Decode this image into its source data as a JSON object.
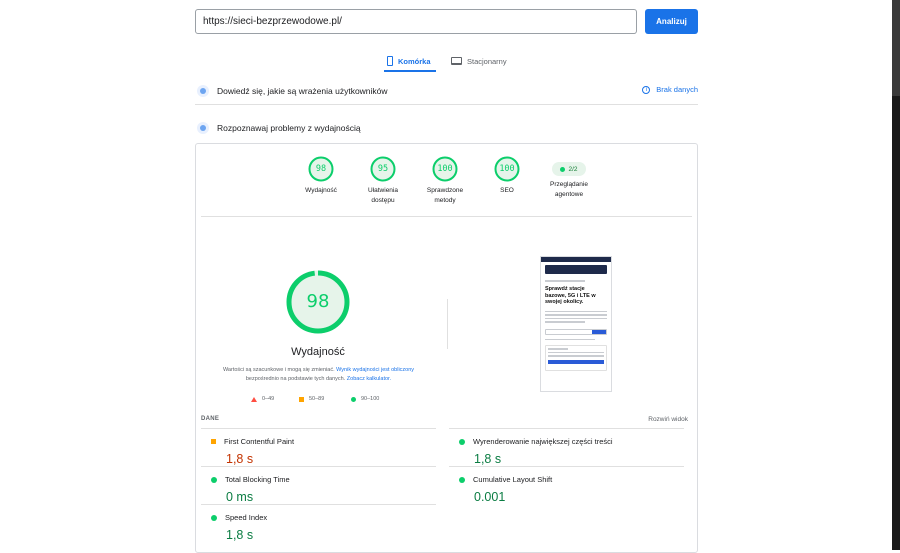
{
  "url_bar": {
    "value": "https://sieci-bezprzewodowe.pl/",
    "analyze_label": "Analizuj"
  },
  "device_tabs": {
    "mobile": "Komórka",
    "desktop": "Stacjonarny"
  },
  "field_section": {
    "title": "Dowiedź się, jakie są wrażenia użytkowników",
    "no_data": "Brak danych"
  },
  "lab_section": {
    "title": "Rozpoznawaj problemy z wydajnością"
  },
  "category_scores": [
    {
      "score": "98",
      "label_line1": "Wydajność",
      "label_line2": ""
    },
    {
      "score": "95",
      "label_line1": "Ułatwienia",
      "label_line2": "dostępu"
    },
    {
      "score": "100",
      "label_line1": "Sprawdzone",
      "label_line2": "metody"
    },
    {
      "score": "100",
      "label_line1": "SEO",
      "label_line2": ""
    }
  ],
  "agentic": {
    "value": "2/2",
    "label_line1": "Przeglądanie",
    "label_line2": "agentowe"
  },
  "performance": {
    "score": "98",
    "score_fraction": 0.98,
    "label": "Wydajność",
    "disclaimer_pre": "Wartości są szacunkowe i mogą się zmieniać.",
    "disclaimer_link1": "Wynik wydajności jest obliczony",
    "disclaimer_mid": "bezpośrednio na podstawie tych danych.",
    "disclaimer_link2": "Zobacz kalkulator."
  },
  "legend": {
    "fail": "0–49",
    "average": "50–89",
    "pass": "90–100"
  },
  "metrics_header": {
    "title": "DANE",
    "expand": "Rozwiń widok"
  },
  "metrics": {
    "fcp": {
      "label": "First Contentful Paint",
      "value": "1,8 s"
    },
    "lcp": {
      "label": "Wyrenderowanie największej części treści",
      "value": "1,8 s"
    },
    "tbt": {
      "label": "Total Blocking Time",
      "value": "0 ms"
    },
    "cls": {
      "label": "Cumulative Layout Shift",
      "value": "0.001"
    },
    "si": {
      "label": "Speed Index",
      "value": "1,8 s"
    }
  },
  "thumbnail": {
    "heading": "Sprawdź stacje bazowe, 5G i LTE w swojej okolicy."
  },
  "colors": {
    "accent": "#1a73e8",
    "pass": "#0cce6b",
    "average": "#ffa400",
    "fail": "#ff4e42"
  }
}
